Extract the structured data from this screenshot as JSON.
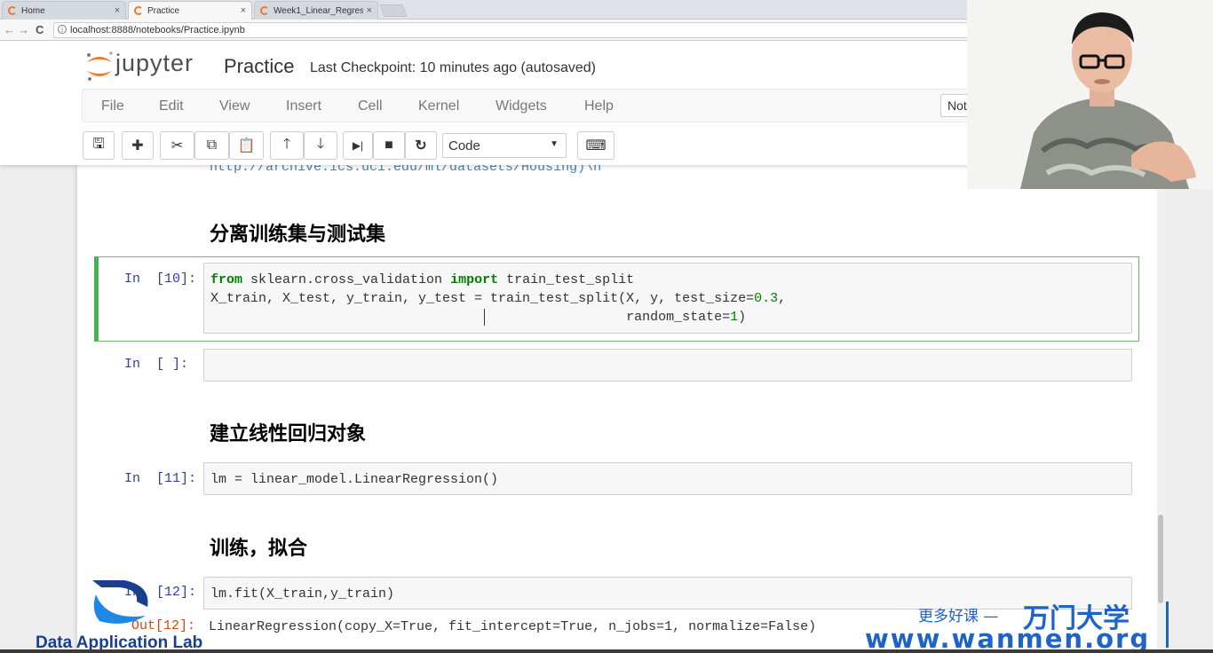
{
  "browser": {
    "tabs": [
      {
        "label": "Home",
        "close": "×"
      },
      {
        "label": "Practice",
        "close": "×"
      },
      {
        "label": "Week1_Linear_Regres",
        "close": "×"
      }
    ],
    "url": "localhost:8888/notebooks/Practice.ipynb",
    "back_glyph": "←",
    "forward_glyph": "→",
    "reload_glyph": "C",
    "info_glyph": "i"
  },
  "jupyter": {
    "logo_text": "jupyter",
    "notebook_title": "Practice",
    "checkpoint": "Last Checkpoint: 10 minutes ago (autosaved)",
    "menu": [
      "File",
      "Edit",
      "View",
      "Insert",
      "Cell",
      "Kernel",
      "Widgets",
      "Help"
    ],
    "kernel_indicator": "Not",
    "cell_type": "Code",
    "cell_type_caret": "▼",
    "toolbar_glyphs": {
      "save": "🖫",
      "add": "✚",
      "cut": "✂",
      "copy": "⧉",
      "paste": "📋",
      "up": "🡑",
      "down": "🡓",
      "run": "▶|",
      "stop": "■",
      "restart": "↻",
      "keyboard": "⌨"
    }
  },
  "notebook": {
    "url_fragment": "http://archive.ics.uci.edu/ml/datasets/Housing)\\n",
    "headings": [
      "分离训练集与测试集",
      "建立线性回归对象",
      "训练，拟合"
    ],
    "cells": [
      {
        "prompt": "In  [10]:",
        "lines": [
          {
            "kw": "from",
            "t1": " sklearn.cross_validation ",
            "kw2": "import",
            "t2": " train_test_split"
          },
          {
            "text": "X_train, X_test, y_train, y_test = train_test_split(X, y, test_size=",
            "num": "0.3",
            "tail": ","
          },
          {
            "text": "                                                    random_state=",
            "num": "1",
            "tail": ")"
          }
        ]
      },
      {
        "prompt": "In  [ ]:"
      },
      {
        "prompt": "In  [11]:",
        "code": "lm = linear_model.LinearRegression()"
      },
      {
        "prompt": "In  [12]:",
        "code": "lm.fit(X_train,y_train)",
        "out_prompt": "Out[12]:",
        "output": "LinearRegression(copy_X=True, fit_intercept=True, n_jobs=1, normalize=False)"
      }
    ]
  },
  "watermarks": {
    "lab": "Data Application Lab",
    "more": "更多好课 —",
    "brand": "万门大学",
    "url": "www.wanmen.org"
  }
}
